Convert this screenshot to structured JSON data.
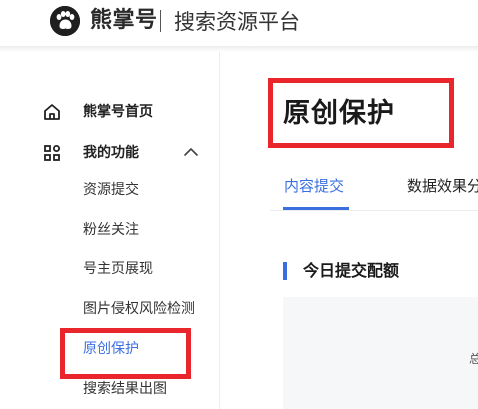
{
  "header": {
    "brand": "熊掌号",
    "platform": "搜索资源平台",
    "logo_icon": "paw-icon"
  },
  "sidebar": {
    "home": {
      "label": "熊掌号首页",
      "icon": "home-icon"
    },
    "my_functions": {
      "label": "我的功能",
      "icon": "grid-icon",
      "chevron": "chevron-up-icon",
      "expanded": true
    },
    "sub_items": [
      {
        "label": "资源提交",
        "active": false
      },
      {
        "label": "粉丝关注",
        "active": false
      },
      {
        "label": "号主页展现",
        "active": false
      },
      {
        "label": "图片侵权风险检测",
        "active": false
      },
      {
        "label": "原创保护",
        "active": true
      },
      {
        "label": "搜索结果出图",
        "active": false
      }
    ]
  },
  "main": {
    "title": "原创保护",
    "tabs": [
      {
        "label": "内容提交",
        "active": true
      },
      {
        "label": "数据效果分",
        "active": false
      }
    ],
    "section_title": "今日提交配额",
    "quota_text": "总"
  },
  "colors": {
    "accent": "#3b6fe0",
    "highlight": "#e8262c",
    "panel_bg": "#f6f7f9"
  }
}
